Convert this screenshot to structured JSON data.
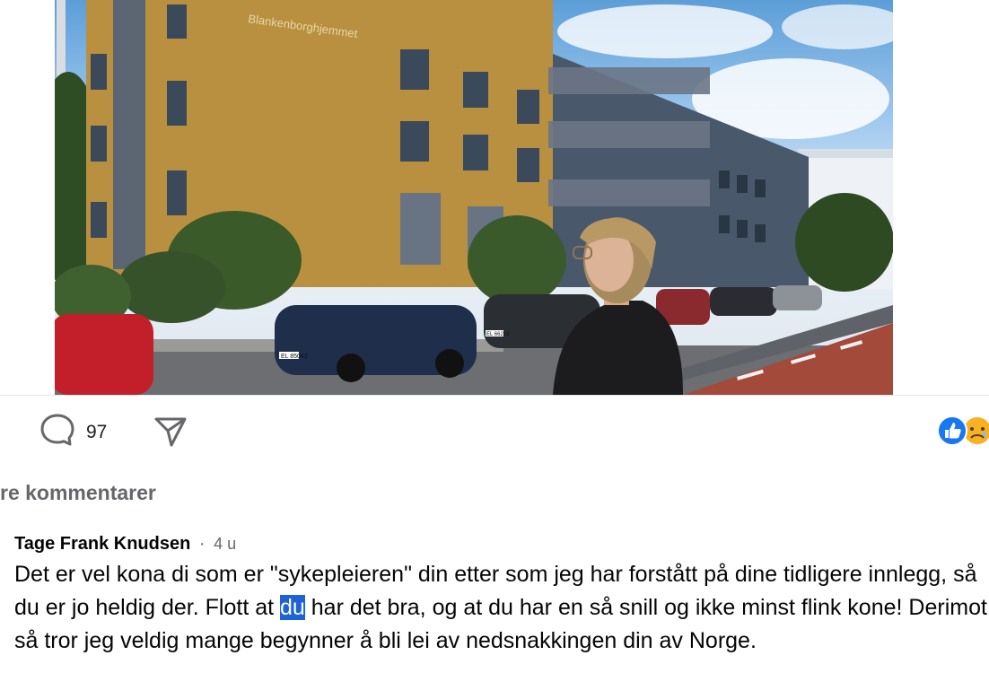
{
  "post": {
    "image": {
      "building_sign": "Blankenborghjemmet",
      "plate_1": "EL 85042",
      "plate_2": "EL 66213"
    },
    "actions": {
      "comment_count": "97",
      "comment_icon": "comment-icon",
      "share_icon": "share-icon"
    },
    "reactions": {
      "icons": [
        "like-icon",
        "sad-icon"
      ],
      "like_color": "#1877f2",
      "sad_color": "#f7b125"
    }
  },
  "comments": {
    "more_label": "re kommentarer",
    "items": [
      {
        "author": "Tage Frank Knudsen",
        "separator": "·",
        "time": "4 u",
        "text_before": "Det er vel kona di som er \"sykepleieren\" din etter som jeg har forstått på dine tidligere innlegg, så du er jo heldig der. Flott at ",
        "text_highlight": "du",
        "text_after": " har det bra, og at du har en så snill og ikke minst flink kone! Derimot så tror jeg veldig mange begynner å bli lei av nedsnakkingen din av Norge."
      }
    ]
  },
  "colors": {
    "selection": "#1d63d6",
    "secondary_text": "#65676b"
  }
}
